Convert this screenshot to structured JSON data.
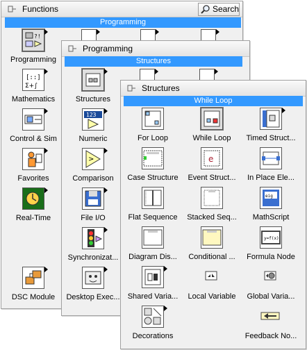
{
  "functions": {
    "title": "Functions",
    "search_label": "Search",
    "category": "Programming",
    "items": [
      {
        "label": "Programming",
        "icon": "programming-icon"
      },
      {
        "label": "Mathematics",
        "icon": "mathematics-icon"
      },
      {
        "label": "Control & Sim",
        "icon": "control-sim-icon"
      },
      {
        "label": "Favorites",
        "icon": "favorites-icon"
      },
      {
        "label": "Real-Time",
        "icon": "real-time-icon"
      },
      {
        "label": "DSC Module",
        "icon": "dsc-module-icon"
      }
    ]
  },
  "programming": {
    "title": "Programming",
    "category": "Structures",
    "items": [
      {
        "label": "Structures",
        "icon": "structures-icon"
      },
      {
        "label": "Numeric",
        "icon": "numeric-icon"
      },
      {
        "label": "Comparison",
        "icon": "comparison-icon"
      },
      {
        "label": "File I/O",
        "icon": "file-io-icon"
      },
      {
        "label": "Synchronizat...",
        "icon": "synchronization-icon"
      },
      {
        "label": "Desktop Exec...",
        "icon": "desktop-execution-icon"
      }
    ]
  },
  "structures": {
    "title": "Structures",
    "category": "While Loop",
    "items": [
      {
        "label": "For Loop",
        "icon": "for-loop-icon"
      },
      {
        "label": "While Loop",
        "icon": "while-loop-icon"
      },
      {
        "label": "Timed Struct...",
        "icon": "timed-structure-icon"
      },
      {
        "label": "Case Structure",
        "icon": "case-structure-icon"
      },
      {
        "label": "Event Struct...",
        "icon": "event-structure-icon"
      },
      {
        "label": "In Place Ele...",
        "icon": "in-place-element-icon"
      },
      {
        "label": "Flat Sequence",
        "icon": "flat-sequence-icon"
      },
      {
        "label": "Stacked Seq...",
        "icon": "stacked-sequence-icon"
      },
      {
        "label": "MathScript",
        "icon": "mathscript-icon"
      },
      {
        "label": "Diagram Dis...",
        "icon": "diagram-disable-icon"
      },
      {
        "label": "Conditional ...",
        "icon": "conditional-disable-icon"
      },
      {
        "label": "Formula Node",
        "icon": "formula-node-icon"
      },
      {
        "label": "Shared Varia...",
        "icon": "shared-variable-icon"
      },
      {
        "label": "Local Variable",
        "icon": "local-variable-icon"
      },
      {
        "label": "Global Varia...",
        "icon": "global-variable-icon"
      },
      {
        "label": "Decorations",
        "icon": "decorations-icon"
      },
      {
        "label": "Feedback No...",
        "icon": "feedback-node-icon"
      }
    ]
  }
}
